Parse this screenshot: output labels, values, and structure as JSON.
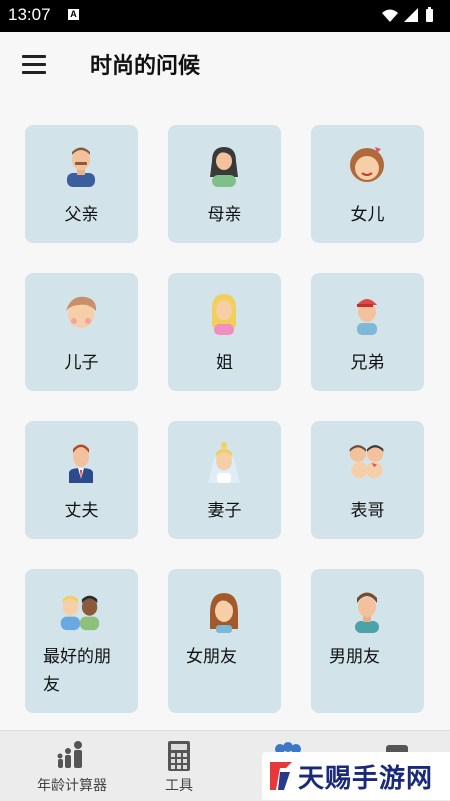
{
  "statusbar": {
    "time": "13:07",
    "notification_icon": "a-icon"
  },
  "appbar": {
    "title": "时尚的问候",
    "menu_icon": "hamburger-menu-icon"
  },
  "cards": [
    {
      "label": "父亲",
      "icon": "father-avatar-icon"
    },
    {
      "label": "母亲",
      "icon": "mother-avatar-icon"
    },
    {
      "label": "女儿",
      "icon": "daughter-avatar-icon"
    },
    {
      "label": "儿子",
      "icon": "son-avatar-icon"
    },
    {
      "label": "姐",
      "icon": "sister-avatar-icon"
    },
    {
      "label": "兄弟",
      "icon": "brother-avatar-icon"
    },
    {
      "label": "丈夫",
      "icon": "husband-avatar-icon"
    },
    {
      "label": "妻子",
      "icon": "wife-avatar-icon"
    },
    {
      "label": "表哥",
      "icon": "cousin-avatar-icon"
    },
    {
      "label": "最好的朋友",
      "icon": "best-friends-avatar-icon"
    },
    {
      "label": "女朋友",
      "icon": "girlfriend-avatar-icon"
    },
    {
      "label": "男朋友",
      "icon": "boyfriend-avatar-icon"
    }
  ],
  "bottomnav": [
    {
      "label": "年龄计算器",
      "icon": "family-icon"
    },
    {
      "label": "工具",
      "icon": "calculator-icon"
    }
  ],
  "watermark": {
    "text": "天赐手游网"
  },
  "colors": {
    "card_bg": "#d3e3ea",
    "background": "#f7f7f7"
  }
}
